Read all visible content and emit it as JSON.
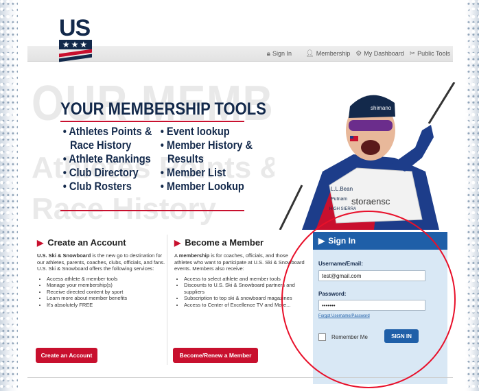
{
  "logo": {
    "text": "US",
    "stars": "★★★"
  },
  "nav": {
    "sign_in": "Sign In",
    "membership": "Membership",
    "dashboard": "My Dashboard",
    "public_tools": "Public Tools"
  },
  "hero": {
    "ghost_line1": "OUR MEMBERSHIP",
    "ghost_line2": "Athletes Points &",
    "ghost_line3": "Race History",
    "title": "YOUR MEMBERSHIP TOOLS",
    "tools_col1": [
      "Athletes Points & Race History",
      "Athlete Rankings",
      "Club Directory",
      "Club Rosters"
    ],
    "tools_col2": [
      "Event lookup",
      "Member History & Results",
      "Member List",
      "Member Lookup"
    ]
  },
  "athlete": {
    "bib_brand": "storaensc",
    "sponsor1": "L.L.Bean",
    "sponsor2": "Putnam",
    "sponsor3": "HIGH SIERRA"
  },
  "create": {
    "title": "Create an Account",
    "intro_bold": "U.S. Ski & Snowboard",
    "intro": " is the new go to destination for our athletes, parents, coaches, clubs, officials, and fans. U.S. Ski & Snowboard offers the following services:",
    "items": [
      "Access athlete & member tools",
      "Manage your membership(s)",
      "Receive directed content by sport",
      "Learn more about member benefits",
      "It's absolutely FREE"
    ],
    "button": "Create an Account"
  },
  "member": {
    "title": "Become a Member",
    "intro_pre": "A ",
    "intro_bold": "membership",
    "intro": " is for coaches, officials, and those athletes who want to participate at U.S. Ski & Snowboard events. Members also receive:",
    "items": [
      "Access to select athlete and member tools",
      "Discounts to U.S. Ski & Snowboard partners and suppliers",
      "Subscription to top ski & snowboard magazines",
      "Access to Center of Excellence TV and More..."
    ],
    "button": "Become/Renew a Member"
  },
  "signin": {
    "title": "Sign In",
    "username_label": "Username/Email:",
    "username_value": "test@gmail.com",
    "password_label": "Password:",
    "password_value": "•••••••",
    "forgot": "Forgot Username/Password",
    "remember": "Remember Me",
    "button": "SIGN IN"
  },
  "colors": {
    "navy": "#13294b",
    "red": "#c8102e",
    "blue": "#1f5fa8",
    "panel": "#d9e8f5",
    "annotation": "#e8102a"
  }
}
